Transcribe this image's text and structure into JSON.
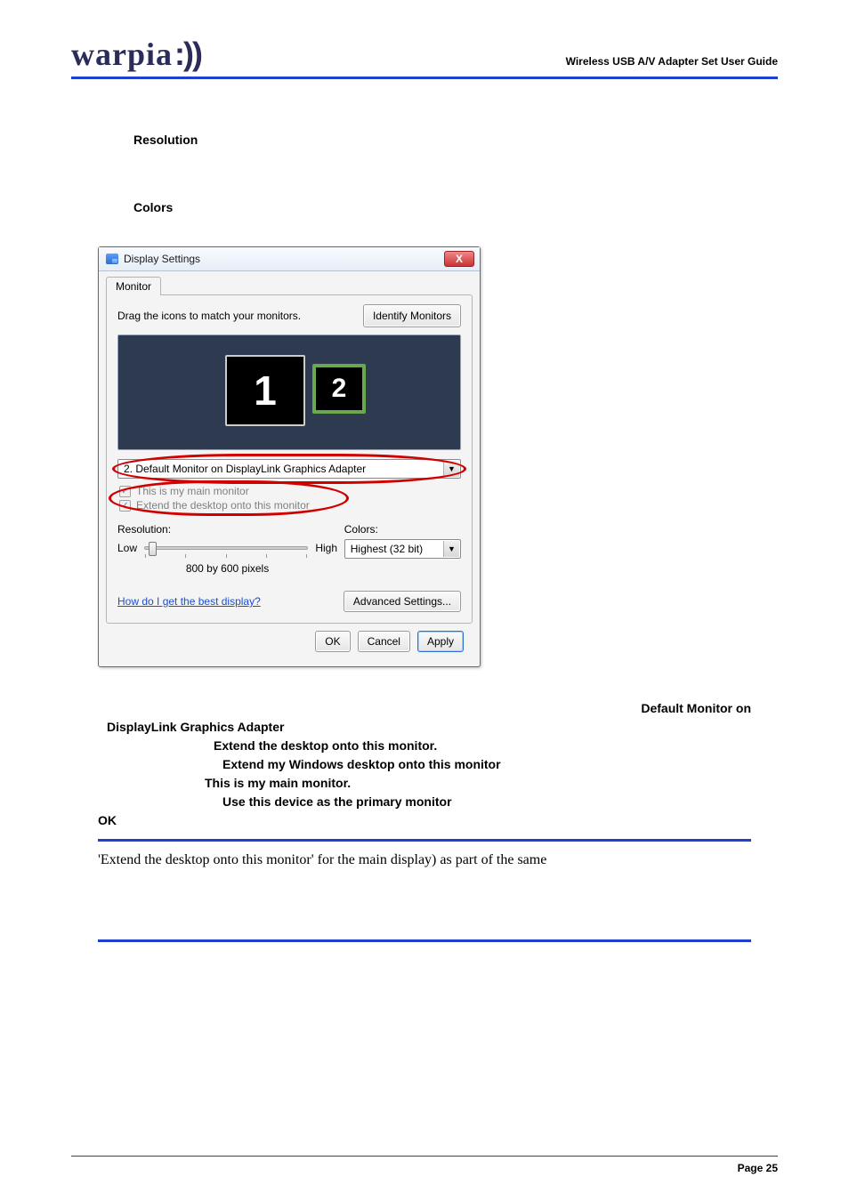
{
  "header": {
    "brand": "warpia",
    "waves": ":))",
    "doc_title": "Wireless USB A/V Adapter Set User Guide"
  },
  "sections": {
    "resolution_heading": "Resolution",
    "colors_heading": "Colors"
  },
  "dialog": {
    "title": "Display Settings",
    "close_glyph": "X",
    "tab": "Monitor",
    "drag_text": "Drag the icons to match your monitors.",
    "identify_btn": "Identify Monitors",
    "monitor1": "1",
    "monitor2": "2",
    "combo_value": "2. Default Monitor on DisplayLink Graphics Adapter",
    "combo_arrow": "▼",
    "chk_main": "This is my main monitor",
    "chk_extend": "Extend the desktop onto this monitor",
    "chk_glyph": "✓",
    "res_label": "Resolution:",
    "colors_label": "Colors:",
    "low": "Low",
    "high": "High",
    "res_value": "800 by 600 pixels",
    "colors_value": "Highest (32 bit)",
    "help_link": "How do I get the best display?",
    "adv_btn": "Advanced Settings...",
    "ok": "OK",
    "cancel": "Cancel",
    "apply": "Apply"
  },
  "inst": {
    "line_right": "Default Monitor on",
    "line2": "DisplayLink Graphics Adapter",
    "extend_bold": "Extend the desktop onto this monitor.",
    "extend_my": "Extend my Windows desktop onto this monitor",
    "main_bold": "This is my main monitor.",
    "use_device": "Use this device as the primary monitor",
    "ok": "OK"
  },
  "note_text": "'Extend the desktop onto this monitor' for the main display) as part of the same",
  "footer": {
    "page": "Page 25"
  }
}
